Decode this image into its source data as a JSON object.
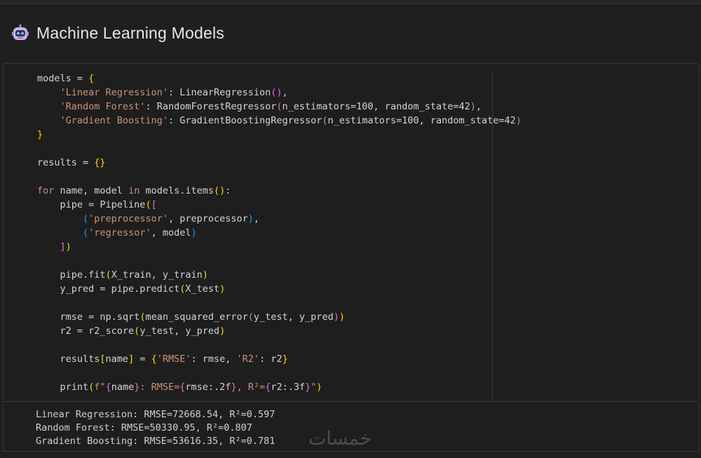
{
  "header": {
    "title": "Machine Learning Models",
    "icon": "robot-icon"
  },
  "code_lines": [
    [
      [
        "models = ",
        "c-plain"
      ],
      [
        "{",
        "b1"
      ]
    ],
    [
      [
        "    ",
        "c-plain"
      ],
      [
        "'Linear Regression'",
        "c-str"
      ],
      [
        ": LinearRegression",
        "c-plain"
      ],
      [
        "()",
        "b2"
      ],
      [
        ",",
        "c-plain"
      ]
    ],
    [
      [
        "    ",
        "c-plain"
      ],
      [
        "'Random Forest'",
        "c-str"
      ],
      [
        ": RandomForestRegressor",
        "c-plain"
      ],
      [
        "(",
        "b2"
      ],
      [
        "n_estimators=100, random_state=42",
        "c-plain"
      ],
      [
        ")",
        "b2"
      ],
      [
        ",",
        "c-plain"
      ]
    ],
    [
      [
        "    ",
        "c-plain"
      ],
      [
        "'Gradient Boosting'",
        "c-str"
      ],
      [
        ": GradientBoostingRegressor",
        "c-plain"
      ],
      [
        "(",
        "b2"
      ],
      [
        "n_estimators=100, random_state=42",
        "c-plain"
      ],
      [
        ")",
        "b2"
      ]
    ],
    [
      [
        "}",
        "b1"
      ]
    ],
    [],
    [
      [
        "results = ",
        "c-plain"
      ],
      [
        "{}",
        "b1"
      ]
    ],
    [],
    [
      [
        "for",
        "c-kw"
      ],
      [
        " name, model ",
        "c-plain"
      ],
      [
        "in",
        "c-kw"
      ],
      [
        " models.items",
        "c-plain"
      ],
      [
        "()",
        "b1"
      ],
      [
        ":",
        "c-plain"
      ]
    ],
    [
      [
        "    pipe = Pipeline",
        "c-plain"
      ],
      [
        "(",
        "b1"
      ],
      [
        "[",
        "b2"
      ]
    ],
    [
      [
        "        ",
        "c-plain"
      ],
      [
        "(",
        "b3"
      ],
      [
        "'preprocessor'",
        "c-str"
      ],
      [
        ", preprocessor",
        "c-plain"
      ],
      [
        ")",
        "b3"
      ],
      [
        ",",
        "c-plain"
      ]
    ],
    [
      [
        "        ",
        "c-plain"
      ],
      [
        "(",
        "b3"
      ],
      [
        "'regressor'",
        "c-str"
      ],
      [
        ", model",
        "c-plain"
      ],
      [
        ")",
        "b3"
      ]
    ],
    [
      [
        "    ",
        "c-plain"
      ],
      [
        "]",
        "b2"
      ],
      [
        ")",
        "b1"
      ]
    ],
    [],
    [
      [
        "    pipe.fit",
        "c-plain"
      ],
      [
        "(",
        "b1"
      ],
      [
        "X_train, y_train",
        "c-plain"
      ],
      [
        ")",
        "b1"
      ]
    ],
    [
      [
        "    y_pred = pipe.predict",
        "c-plain"
      ],
      [
        "(",
        "b1"
      ],
      [
        "X_test",
        "c-plain"
      ],
      [
        ")",
        "b1"
      ]
    ],
    [],
    [
      [
        "    rmse = np.sqrt",
        "c-plain"
      ],
      [
        "(",
        "b1"
      ],
      [
        "mean_squared_error",
        "c-plain"
      ],
      [
        "(",
        "b2"
      ],
      [
        "y_test, y_pred",
        "c-plain"
      ],
      [
        ")",
        "b2"
      ],
      [
        ")",
        "b1"
      ]
    ],
    [
      [
        "    r2 = r2_score",
        "c-plain"
      ],
      [
        "(",
        "b1"
      ],
      [
        "y_test, y_pred",
        "c-plain"
      ],
      [
        ")",
        "b1"
      ]
    ],
    [],
    [
      [
        "    results",
        "c-plain"
      ],
      [
        "[",
        "b1"
      ],
      [
        "name",
        "c-plain"
      ],
      [
        "]",
        "b1"
      ],
      [
        " = ",
        "c-plain"
      ],
      [
        "{",
        "b1"
      ],
      [
        "'RMSE'",
        "c-str"
      ],
      [
        ": rmse, ",
        "c-plain"
      ],
      [
        "'R2'",
        "c-str"
      ],
      [
        ": r2",
        "c-plain"
      ],
      [
        "}",
        "b1"
      ]
    ],
    [],
    [
      [
        "    print",
        "c-plain"
      ],
      [
        "(",
        "b1"
      ],
      [
        "f\"",
        "c-str"
      ],
      [
        "{",
        "b2"
      ],
      [
        "name",
        "c-plain"
      ],
      [
        "}",
        "b2"
      ],
      [
        ": RMSE=",
        "c-str"
      ],
      [
        "{",
        "b2"
      ],
      [
        "rmse:.2f",
        "c-plain"
      ],
      [
        "}",
        "b2"
      ],
      [
        ", R²=",
        "c-str"
      ],
      [
        "{",
        "b2"
      ],
      [
        "r2:.3f",
        "c-plain"
      ],
      [
        "}",
        "b2"
      ],
      [
        "\"",
        "c-str"
      ],
      [
        ")",
        "b1"
      ]
    ]
  ],
  "output_lines": [
    "Linear Regression: RMSE=72668.54, R²=0.597",
    "Random Forest: RMSE=50330.95, R²=0.807",
    "Gradient Boosting: RMSE=53616.35, R²=0.781"
  ],
  "watermark": "خمسات",
  "colors": {
    "background": "#1f1f1f",
    "string": "#ce9178",
    "keyword": "#c586c0",
    "bracket_gold": "#ffd700",
    "bracket_orchid": "#da70d6",
    "bracket_blue": "#179fff"
  }
}
